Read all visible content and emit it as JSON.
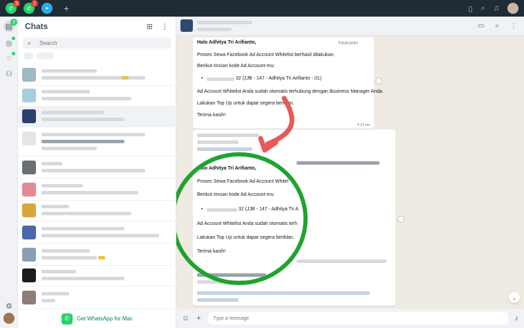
{
  "topbar": {
    "whatsapp_badge_1": "3",
    "whatsapp_badge_2": "2"
  },
  "rail": {
    "chats_badge": "3"
  },
  "chatlist": {
    "title": "Chats",
    "search_placeholder": "Search",
    "footer_label": "Get WhatsApp for Mac"
  },
  "conversation": {
    "message_1": {
      "greeting": "Halo Adhitya Tri Arifianto,",
      "day": "THURSDAY",
      "line1": "Proses Sewa Facebook Ad Account Whitelist berhasil dilakukan.",
      "line2": "Berikut rincian kode Ad Account-mu:",
      "code": "32 (JJB - 147 - Adhitya Tri Arifianto - 01)",
      "line3": "Ad Account Whitelist Anda sudah otomatis terhubung dengan Business Manager Anda.",
      "line4": "Lakukan Top Up untuk dapat segera beriklan.",
      "line5": "Terima kasih!",
      "time": "4:21 pm"
    },
    "message_2": {
      "greeting": "Halo Adhitya Tri Arifianto,",
      "line1": "Proses Sewa Facebook Ad Account Whitel",
      "line2": "Berikut rincian kode Ad Account-mu:",
      "code": "32 (JJB - 147 - Adhitya Tri A",
      "line3": "Ad Account Whitelist Anda sudah otomatis terh",
      "line4": "Lakukan Top Up untuk dapat segera beriklan.",
      "line5": "Terima kasih!"
    },
    "input_placeholder": "Type a message"
  },
  "colors": {
    "whatsapp_green": "#25d366",
    "annotation_circle": "#1fa32e",
    "annotation_arrow": "#e85a56",
    "topbar": "#1f2c33"
  }
}
